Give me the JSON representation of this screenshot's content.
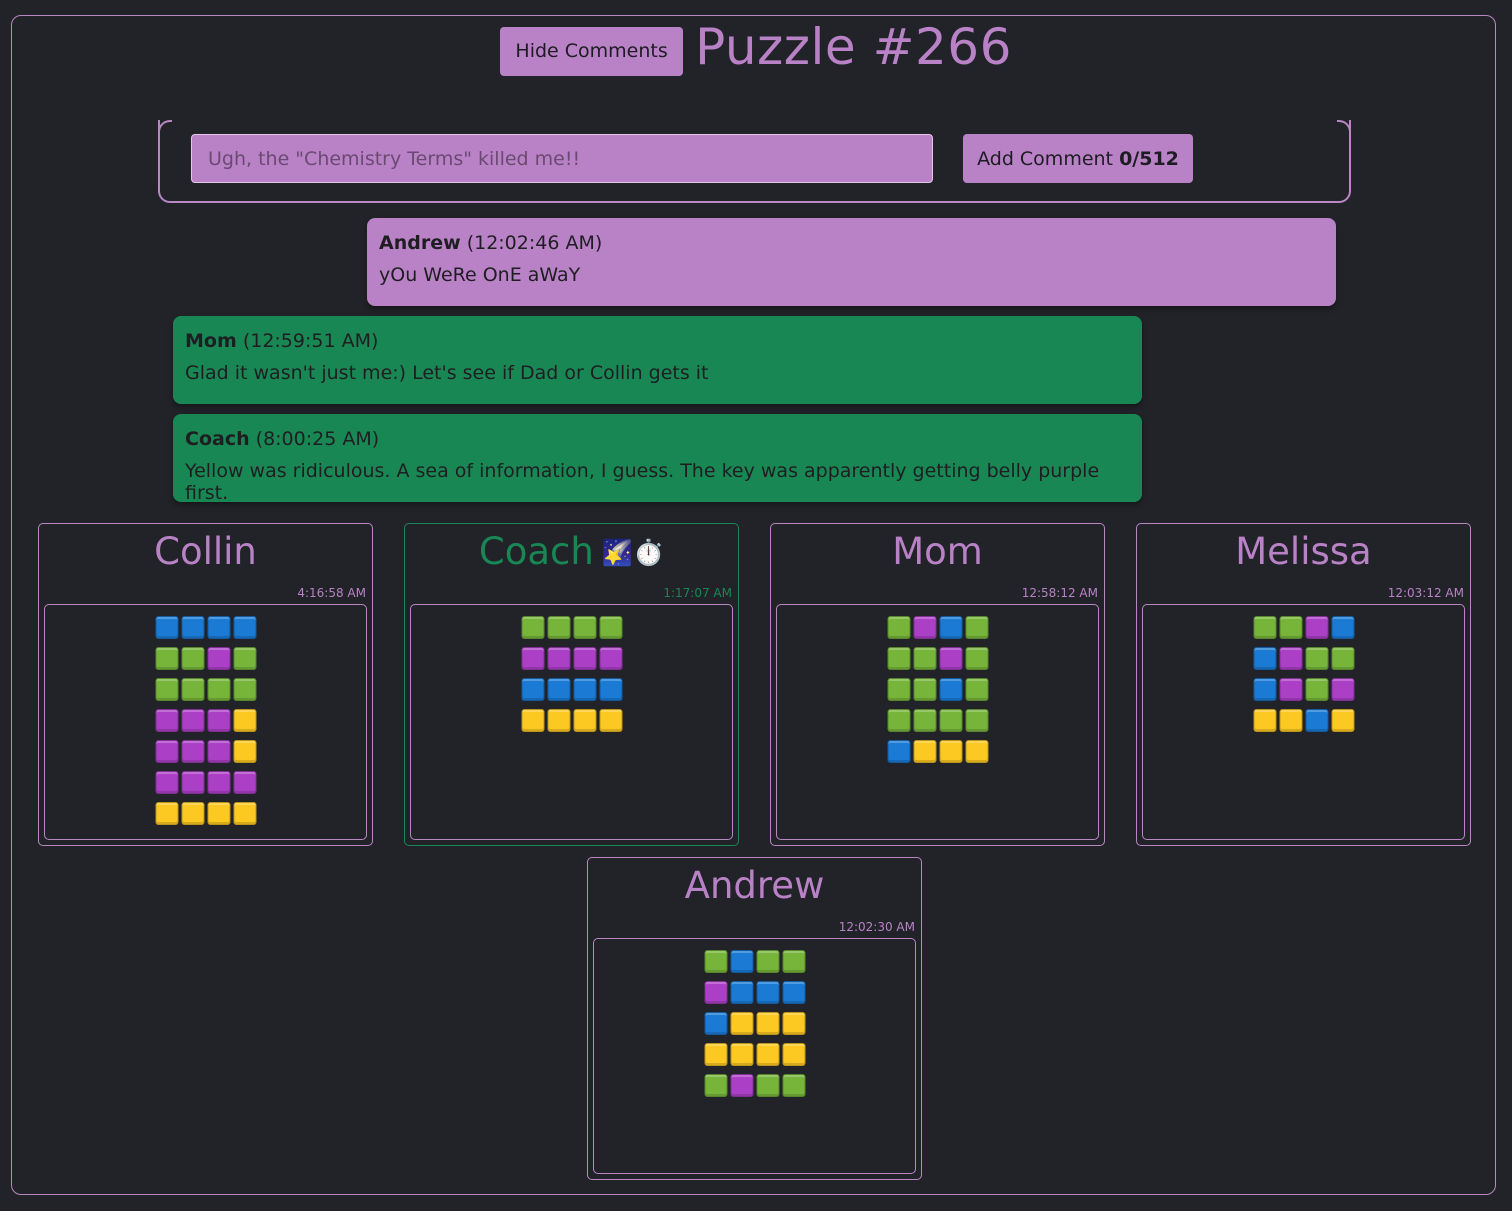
{
  "header": {
    "hide_button": "Hide Comments",
    "title": "Puzzle #266"
  },
  "comment_form": {
    "placeholder": "Ugh, the \"Chemistry Terms\" killed me!!",
    "add_label": "Add Comment",
    "char_count": "0/512"
  },
  "comments": [
    {
      "author": "Andrew",
      "time": "(12:02:46 AM)",
      "text": "yOu WeRe OnE aWaY",
      "color": "purple"
    },
    {
      "author": "Mom",
      "time": "(12:59:51 AM)",
      "text": "Glad it wasn't just me:) Let's see if Dad or Collin gets it",
      "color": "green"
    },
    {
      "author": "Coach",
      "time": "(8:00:25 AM)",
      "text": "Yellow was ridiculous. A sea of information, I guess. The key was apparently getting belly purple first.",
      "color": "green"
    }
  ],
  "players": [
    {
      "name": "Collin",
      "emoji": "",
      "time": "4:16:58 AM",
      "active": false,
      "rows": [
        [
          "blue",
          "blue",
          "blue",
          "blue"
        ],
        [
          "green",
          "green",
          "purple",
          "green"
        ],
        [
          "green",
          "green",
          "green",
          "green"
        ],
        [
          "purple",
          "purple",
          "purple",
          "yellow"
        ],
        [
          "purple",
          "purple",
          "purple",
          "yellow"
        ],
        [
          "purple",
          "purple",
          "purple",
          "purple"
        ],
        [
          "yellow",
          "yellow",
          "yellow",
          "yellow"
        ]
      ]
    },
    {
      "name": "Coach",
      "emoji": "🌠⏱️",
      "time": "1:17:07 AM",
      "active": true,
      "rows": [
        [
          "green",
          "green",
          "green",
          "green"
        ],
        [
          "purple",
          "purple",
          "purple",
          "purple"
        ],
        [
          "blue",
          "blue",
          "blue",
          "blue"
        ],
        [
          "yellow",
          "yellow",
          "yellow",
          "yellow"
        ]
      ]
    },
    {
      "name": "Mom",
      "emoji": "",
      "time": "12:58:12 AM",
      "active": false,
      "rows": [
        [
          "green",
          "purple",
          "blue",
          "green"
        ],
        [
          "green",
          "green",
          "purple",
          "green"
        ],
        [
          "green",
          "green",
          "blue",
          "green"
        ],
        [
          "green",
          "green",
          "green",
          "green"
        ],
        [
          "blue",
          "yellow",
          "yellow",
          "yellow"
        ]
      ]
    },
    {
      "name": "Melissa",
      "emoji": "",
      "time": "12:03:12 AM",
      "active": false,
      "rows": [
        [
          "green",
          "green",
          "purple",
          "blue"
        ],
        [
          "blue",
          "purple",
          "green",
          "green"
        ],
        [
          "blue",
          "purple",
          "green",
          "purple"
        ],
        [
          "yellow",
          "yellow",
          "blue",
          "yellow"
        ]
      ]
    },
    {
      "name": "Andrew",
      "emoji": "",
      "time": "12:02:30 AM",
      "active": false,
      "rows": [
        [
          "green",
          "blue",
          "green",
          "green"
        ],
        [
          "purple",
          "blue",
          "blue",
          "blue"
        ],
        [
          "blue",
          "yellow",
          "yellow",
          "yellow"
        ],
        [
          "yellow",
          "yellow",
          "yellow",
          "yellow"
        ],
        [
          "green",
          "purple",
          "green",
          "green"
        ]
      ]
    }
  ],
  "colors": {
    "accent": "#b982c6",
    "highlight": "#198754",
    "background": "#212328"
  }
}
